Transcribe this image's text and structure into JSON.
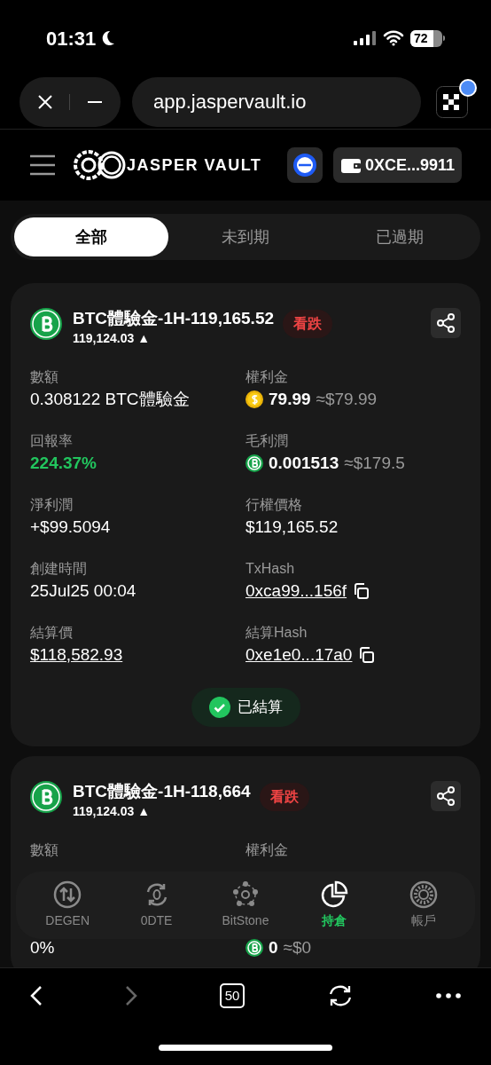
{
  "status_bar": {
    "time": "01:31",
    "battery": "72"
  },
  "browser": {
    "url": "app.jaspervault.io",
    "tab_count": "50"
  },
  "header": {
    "brand": "JASPER VAULT",
    "wallet": "0XCE...9911"
  },
  "tabs": [
    {
      "label": "全部",
      "selected": true
    },
    {
      "label": "未到期",
      "selected": false
    },
    {
      "label": "已過期",
      "selected": false
    }
  ],
  "cards": [
    {
      "title": "BTC體驗金-1H-119,165.52",
      "price": "119,124.03 ▲",
      "direction": "看跌",
      "fields": [
        {
          "label": "數額",
          "kind": "text",
          "value": "0.308122 BTC體驗金"
        },
        {
          "label": "權利金",
          "kind": "usd_coin",
          "amount": "79.99",
          "approx": "≈$79.99"
        },
        {
          "label": "回報率",
          "kind": "gain",
          "value": "224.37%"
        },
        {
          "label": "毛利潤",
          "kind": "btc_coin",
          "amount": "0.001513",
          "approx": "≈$179.5"
        },
        {
          "label": "淨利潤",
          "kind": "text",
          "value": "+$99.5094"
        },
        {
          "label": "行權價格",
          "kind": "text",
          "value": "$119,165.52"
        },
        {
          "label": "創建時間",
          "kind": "text",
          "value": "25Jul25 00:04"
        },
        {
          "label": "TxHash",
          "kind": "hash",
          "value": "0xca99...156f"
        },
        {
          "label": "結算價",
          "kind": "link",
          "value": "$118,582.93"
        },
        {
          "label": "結算Hash",
          "kind": "hash",
          "value": "0xe1e0...17a0"
        }
      ],
      "status": "已結算"
    },
    {
      "title": "BTC體驗金-1H-118,664",
      "price": "119,124.03 ▲",
      "direction": "看跌",
      "fields": [
        {
          "label": "數額"
        },
        {
          "label": "權利金"
        },
        {
          "kind": "text",
          "value": "0%"
        },
        {
          "kind": "btc_coin",
          "amount": "0",
          "approx": "≈$0"
        }
      ]
    }
  ],
  "bottom_nav": [
    {
      "label": "DEGEN",
      "selected": false
    },
    {
      "label": "0DTE",
      "selected": false
    },
    {
      "label": "BitStone",
      "selected": false
    },
    {
      "label": "持倉",
      "selected": true
    },
    {
      "label": "帳戶",
      "selected": false
    }
  ]
}
